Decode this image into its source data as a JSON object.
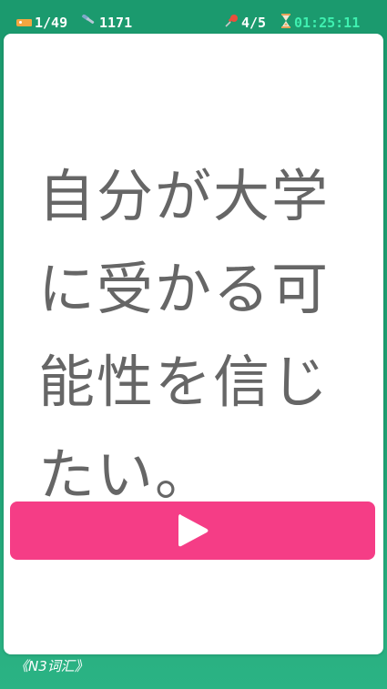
{
  "status": {
    "cards": "1/49",
    "score": "1171",
    "progress": "4/5",
    "timer": "01:25:11",
    "icons": {
      "cards": "tag-icon",
      "score": "hammer-icon",
      "progress": "pin-icon",
      "timer": "hourglass-icon"
    }
  },
  "card": {
    "sentence": "自分が大学に受かる可能性を信じたい。",
    "play_icon": "play-icon"
  },
  "footer": {
    "deck_name": "《N3词汇》"
  },
  "colors": {
    "background": "#1f9f72",
    "timer_text": "#3ff0b0",
    "play_button": "#f53d86",
    "card": "#ffffff",
    "sentence_text": "#666666"
  }
}
